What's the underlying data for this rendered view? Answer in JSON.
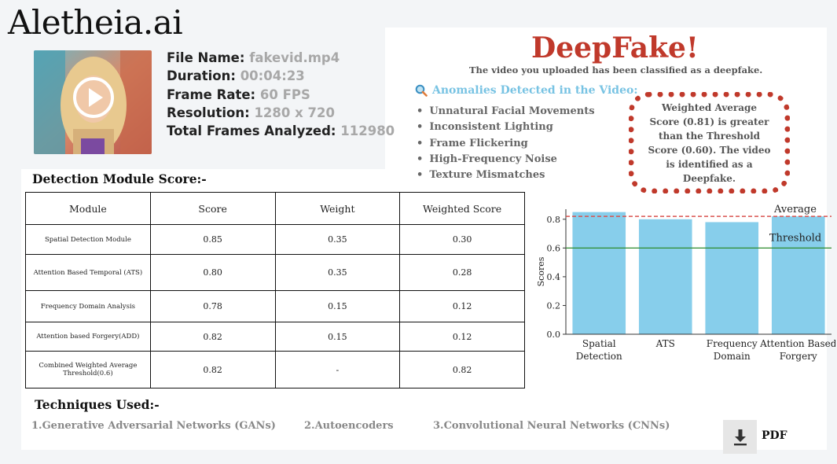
{
  "brand": {
    "logo_text": "Aletheia.ai"
  },
  "video": {
    "thumbnail_icon": "play-icon",
    "fields": [
      {
        "label": "File Name:",
        "value": "fakevid.mp4"
      },
      {
        "label": "Duration:",
        "value": "00:04:23"
      },
      {
        "label": "Frame Rate:",
        "value": "60 FPS"
      },
      {
        "label": "Resolution:",
        "value": "1280 x 720"
      },
      {
        "label": "Total Frames Analyzed:",
        "value": "112980"
      }
    ]
  },
  "result": {
    "verdict": "DeepFake!",
    "subtitle": "The video you uploaded has been classified as a deepfake.",
    "verdict_color": "#c0392b",
    "anomalies_title": "Anomalies Detected in the Video:",
    "anomalies_icon": "magnifier-icon",
    "anomalies": [
      "Unnatural Facial Movements",
      "Inconsistent Lighting",
      "Frame Flickering",
      "High-Frequency Noise",
      "Texture Mismatches"
    ],
    "score_note": "Weighted Average Score (0.81) is greater than the Threshold Score (0.60). The video is identified as a Deepfake."
  },
  "scores": {
    "title": "Detection Module Score:-",
    "headers": [
      "Module",
      "Score",
      "Weight",
      "Weighted Score"
    ],
    "rows": [
      [
        "Spatial Detection Module",
        "0.85",
        "0.35",
        "0.30"
      ],
      [
        "Attention Based Temporal (ATS)",
        "0.80",
        "0.35",
        "0.28"
      ],
      [
        "Frequency Domain Analysis",
        "0.78",
        "0.15",
        "0.12"
      ],
      [
        "Attention based Forgery(ADD)",
        "0.82",
        "0.15",
        "0.12"
      ],
      [
        "Combined Weighted Average Threshold(0.6)",
        "0.82",
        "-",
        "0.82"
      ]
    ]
  },
  "techniques": {
    "title": "Techniques Used:-",
    "items": [
      "1.Generative Adversarial Networks (GANs)",
      "2.Autoencoders",
      "3.Convolutional Neural Networks (CNNs)"
    ]
  },
  "download": {
    "icon": "download-icon",
    "label": "PDF"
  },
  "chart_data": {
    "type": "bar",
    "categories": [
      [
        "Spatial",
        "Detection"
      ],
      [
        "ATS"
      ],
      [
        "Frequency",
        "Domain"
      ],
      [
        "Attention Based",
        "Forgery"
      ]
    ],
    "values": [
      0.85,
      0.8,
      0.78,
      0.82
    ],
    "ylabel": "Scores",
    "ylim": [
      0,
      0.87
    ],
    "yticks": [
      "0.0",
      "0.2",
      "0.4",
      "0.6",
      "0.8"
    ],
    "bar_color": "#87ceeb",
    "average": {
      "value": 0.82,
      "label": "Average",
      "color": "#d9534f"
    },
    "threshold": {
      "value": 0.6,
      "label": "Threshold",
      "color": "#2e8b2e"
    },
    "grid": false
  }
}
